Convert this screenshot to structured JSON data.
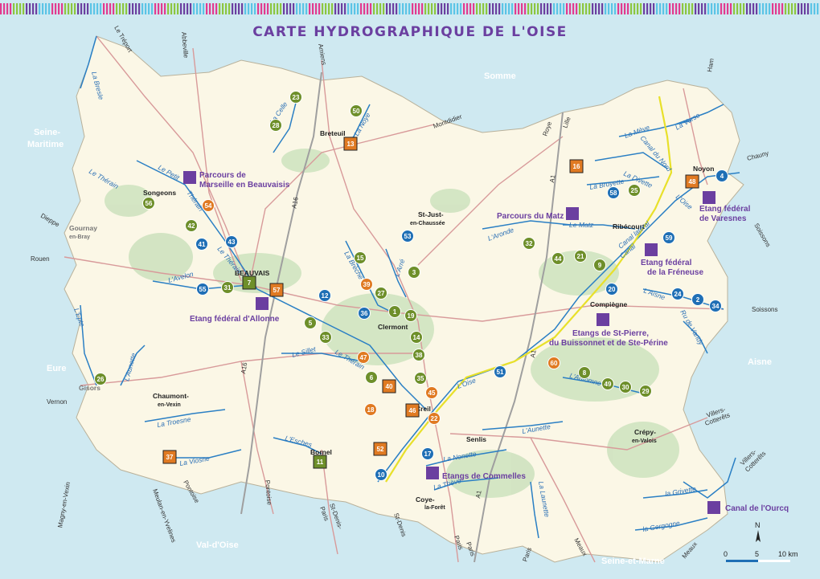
{
  "title": "CARTE HYDROGRAPHIQUE DE L'OISE",
  "colors": {
    "sea": "#cfe9f1",
    "land": "#fbf7e6",
    "forest": "#cfe3c0",
    "river": "#2a7fc4",
    "road": "#d89a9a",
    "canal": "#e8e02a",
    "site": "#6b3fa0",
    "green_marker": "#6e8f2a",
    "orange_marker": "#e07a22",
    "blue_marker": "#1f6fb5",
    "star": "#5bc4e6"
  },
  "regions": [
    "Somme",
    "Seine-Maritime",
    "Eure",
    "Aisne",
    "Val-d'Oise",
    "Seine-et-Marne"
  ],
  "region_labels": {
    "somme": "Somme",
    "seine_1": "Seine-",
    "seine_2": "Maritime",
    "eure": "Eure",
    "aisne": "Aisne",
    "val_oise": "Val-d'Oise",
    "seine_marne": "Seine-et-Marne"
  },
  "towns": {
    "beauvais": "BEAUVAIS",
    "breteuil": "Breteuil",
    "songeons": "Songeons",
    "st_just_1": "St-Just-",
    "st_just_2": "en-Chaussée",
    "clermont": "Clermont",
    "creil": "Creil",
    "senlis": "Senlis",
    "compiegne": "Compiègne",
    "noyon": "Noyon",
    "ribecourt": "Ribécourt",
    "chaumont_1": "Chaumont-",
    "chaumont_2": "en-Vexin",
    "bornel": "Bornel",
    "coye_1": "Coye-",
    "coye_2": "la-Forêt",
    "crepy_1": "Crépy-",
    "crepy_2": "en-Valois",
    "gisors": "Gisors",
    "gournay_1": "Gournay",
    "gournay_2": "en-Bray"
  },
  "road_destinations": {
    "le_treport": "Le Tréport",
    "abbeville": "Abbeville",
    "amiens": "Amiens",
    "montdidier": "Montdidier",
    "roye": "Roye",
    "lille": "Lille",
    "ham": "Ham",
    "chauny": "Chauny",
    "soissons_1": "Soissons",
    "soissons_2": "Soissons",
    "dieppe": "Dieppe",
    "rouen": "Rouen",
    "vernon": "Vernon",
    "pontoise_1": "Pontoise",
    "pontoise_2": "Pontoise",
    "meulan": "Meulan-en-Yvelines",
    "magny": "Magny-en-Vexin",
    "st_denis_1": "St-Denis-",
    "st_denis_2": "Paris",
    "st_denis_3": "St-Denis",
    "paris_1": "Paris",
    "paris_2": "Paris",
    "paris_3": "Paris",
    "meaux_1": "Meaux",
    "meaux_2": "Meaux",
    "villers_1": "Villers-",
    "villers_2": "Cotterêts",
    "villers_3": "Villers-",
    "villers_4": "Cotterêts",
    "a16_1": "A16",
    "a16_2": "A16",
    "a1_1": "A1",
    "a1_2": "A1",
    "a1_3": "A1"
  },
  "rivers": {
    "bresle": "La Bresle",
    "celle": "La Celle",
    "noye": "La Noye",
    "petit_therain": "Le Petit",
    "therain_1": "Le Thérain",
    "therain_2": "Thérain",
    "therain_3": "Le Thérain",
    "therain_4": "Le Thérain",
    "breche": "La Brèche",
    "arre": "L'Arré",
    "avelon": "L'Avelon",
    "epte": "L'Epte",
    "aunette_1": "L'Aunette",
    "sillet": "Le Sillet",
    "troesne": "La Troesne",
    "viosne": "La Viosne",
    "esches": "L'Esches",
    "oise_1": "L'Oise",
    "oise_2": "L'Oise",
    "theve": "La Thève",
    "nonette": "La Nonette",
    "aunette_2": "L'Aunette",
    "launette": "La Launette",
    "automne": "L'Automne",
    "grivette": "la Grivette",
    "gergogne": "la Gergogne",
    "aronde": "L'Aronde",
    "matz": "Le Matz",
    "broyette": "La Broyette",
    "divette": "La Divette",
    "verse": "La Verse",
    "meve": "La Mève",
    "aisne": "L'Aisne",
    "vandy": "Ru de Vandy",
    "canal_nord": "Canal du Nord",
    "canal_lateral": "Canal latéral",
    "canal_1": "Canal"
  },
  "sites": {
    "marseille_1": "Parcours de",
    "marseille_2": "Marseille en Beauvaisis",
    "matz": "Parcours du Matz",
    "varesnes_1": "Etang fédéral",
    "varesnes_2": "de Varesnes",
    "freneuse_1": "Etang fédéral",
    "freneuse_2": "de la Fréneuse",
    "allonne": "Etang fédéral d'Allonne",
    "stpierre_1": "Etangs de St-Pierre,",
    "stpierre_2": "du Buissonnet et de Ste-Périne",
    "commelles": "Etangs de Commelles",
    "ourcq": "Canal de l'Ourcq"
  },
  "markers": [
    {
      "n": "23",
      "type": "green"
    },
    {
      "n": "28",
      "type": "green"
    },
    {
      "n": "50",
      "type": "green"
    },
    {
      "n": "13",
      "type": "orange-sq"
    },
    {
      "n": "56",
      "type": "green"
    },
    {
      "n": "54",
      "type": "orange"
    },
    {
      "n": "42",
      "type": "green"
    },
    {
      "n": "41",
      "type": "blue"
    },
    {
      "n": "43",
      "type": "blue"
    },
    {
      "n": "53",
      "type": "blue"
    },
    {
      "n": "15",
      "type": "green"
    },
    {
      "n": "3",
      "type": "green"
    },
    {
      "n": "39",
      "type": "orange"
    },
    {
      "n": "27",
      "type": "green"
    },
    {
      "n": "55",
      "type": "blue"
    },
    {
      "n": "31",
      "type": "green"
    },
    {
      "n": "7",
      "type": "green-sq"
    },
    {
      "n": "57",
      "type": "orange-sq"
    },
    {
      "n": "12",
      "type": "blue"
    },
    {
      "n": "36",
      "type": "blue"
    },
    {
      "n": "1",
      "type": "green"
    },
    {
      "n": "19",
      "type": "green"
    },
    {
      "n": "5",
      "type": "green"
    },
    {
      "n": "33",
      "type": "green"
    },
    {
      "n": "14",
      "type": "green"
    },
    {
      "n": "38",
      "type": "green"
    },
    {
      "n": "47",
      "type": "orange"
    },
    {
      "n": "6",
      "type": "green"
    },
    {
      "n": "35",
      "type": "green"
    },
    {
      "n": "40",
      "type": "orange-sq"
    },
    {
      "n": "45",
      "type": "orange"
    },
    {
      "n": "18",
      "type": "orange"
    },
    {
      "n": "46",
      "type": "orange-sq"
    },
    {
      "n": "22",
      "type": "orange"
    },
    {
      "n": "26",
      "type": "green"
    },
    {
      "n": "37",
      "type": "orange-sq"
    },
    {
      "n": "11",
      "type": "green-sq"
    },
    {
      "n": "52",
      "type": "orange-sq"
    },
    {
      "n": "10",
      "type": "blue"
    },
    {
      "n": "17",
      "type": "blue"
    },
    {
      "n": "16",
      "type": "orange-sq"
    },
    {
      "n": "58",
      "type": "blue"
    },
    {
      "n": "25",
      "type": "green"
    },
    {
      "n": "48",
      "type": "orange-sq"
    },
    {
      "n": "4",
      "type": "blue"
    },
    {
      "n": "32",
      "type": "green"
    },
    {
      "n": "44",
      "type": "green"
    },
    {
      "n": "21",
      "type": "green"
    },
    {
      "n": "9",
      "type": "green"
    },
    {
      "n": "59",
      "type": "blue"
    },
    {
      "n": "20",
      "type": "blue"
    },
    {
      "n": "24",
      "type": "blue"
    },
    {
      "n": "2",
      "type": "blue"
    },
    {
      "n": "34",
      "type": "blue"
    },
    {
      "n": "51",
      "type": "blue"
    },
    {
      "n": "60",
      "type": "orange"
    },
    {
      "n": "8",
      "type": "green"
    },
    {
      "n": "49",
      "type": "green"
    },
    {
      "n": "30",
      "type": "green"
    },
    {
      "n": "29",
      "type": "green"
    }
  ],
  "compass": "N",
  "scale_bar": {
    "ticks": [
      "0",
      "5",
      "10 km"
    ]
  }
}
